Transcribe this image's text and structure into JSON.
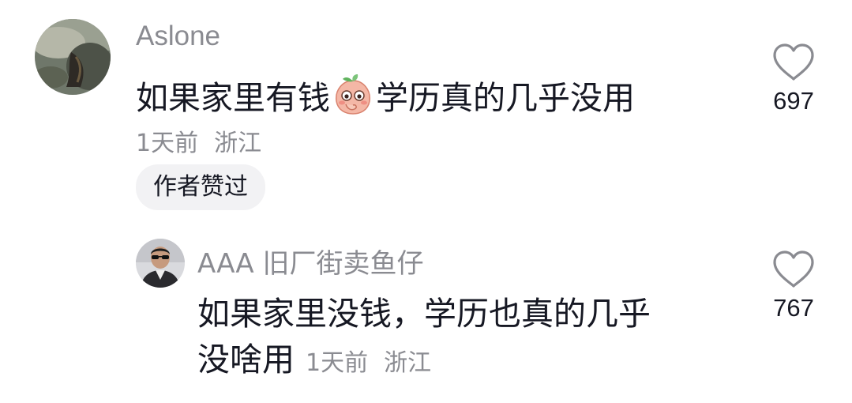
{
  "comments": [
    {
      "username": "Aslone",
      "text_before_emoji": "如果家里有钱",
      "emoji": "shy-peach-emoji",
      "text_after_emoji": "学历真的几乎没用",
      "time": "1天前",
      "location": "浙江",
      "badge": "作者赞过",
      "likes": "697",
      "reply": {
        "username": "AAA 旧厂街卖鱼仔",
        "text_line1": "如果家里没钱，学历也真的几乎",
        "text_line2": "没啥用",
        "time": "1天前",
        "location": "浙江",
        "likes": "767"
      }
    }
  ],
  "colors": {
    "primary_text": "#161823",
    "secondary_text": "#8a8b91",
    "badge_bg": "#f2f2f4",
    "heart_outline": "#8a8b91"
  }
}
